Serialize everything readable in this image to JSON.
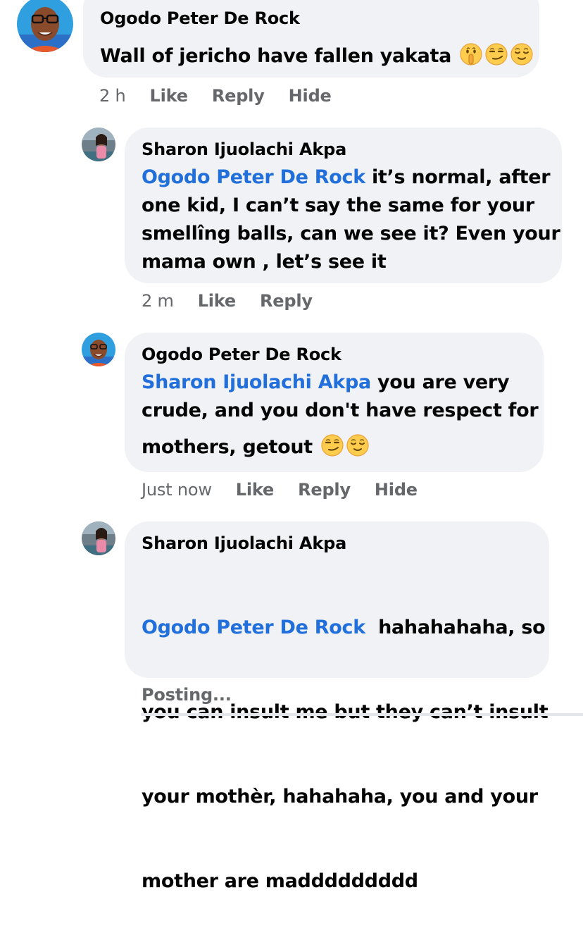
{
  "comments": [
    {
      "author": "Ogodo Peter De Rock",
      "text": "Wall of jericho have fallen yakata",
      "emojis": [
        "shushing-face-emoji",
        "smirking-face-emoji",
        "relieved-face-emoji"
      ],
      "time": "2 h",
      "actions": [
        "Like",
        "Reply",
        "Hide"
      ]
    },
    {
      "author": "Sharon Ijuolachi Akpa",
      "mention": "Ogodo Peter De Rock",
      "lines": [
        " it’s normal, after",
        "one kid, I can’t say the same for your",
        "smellîng balls, can we see it? Even your",
        "mama own , let’s see it"
      ],
      "time": "2 m",
      "actions": [
        "Like",
        "Reply"
      ]
    },
    {
      "author": "Ogodo Peter De Rock",
      "mention": "Sharon Ijuolachi Akpa",
      "lines": [
        " you are very",
        "crude, and you don't have respect for",
        "mothers, getout"
      ],
      "emojis": [
        "smirking-face-emoji",
        "relieved-face-emoji"
      ],
      "time": "Just now",
      "actions": [
        "Like",
        "Reply",
        "Hide"
      ]
    },
    {
      "author": "Sharon Ijuolachi Akpa",
      "mention": "Ogodo Peter De Rock",
      "lines": [
        "  hahahahaha, so",
        "you can insult me but they can’t insult",
        "your mothèr, hahahaha, you and your",
        "mother are maddddddddd"
      ],
      "status": "Posting..."
    }
  ],
  "colors": {
    "bubble": "#f0f2f5",
    "mention": "#216fdb",
    "meta": "#65676b",
    "text": "#050505"
  }
}
